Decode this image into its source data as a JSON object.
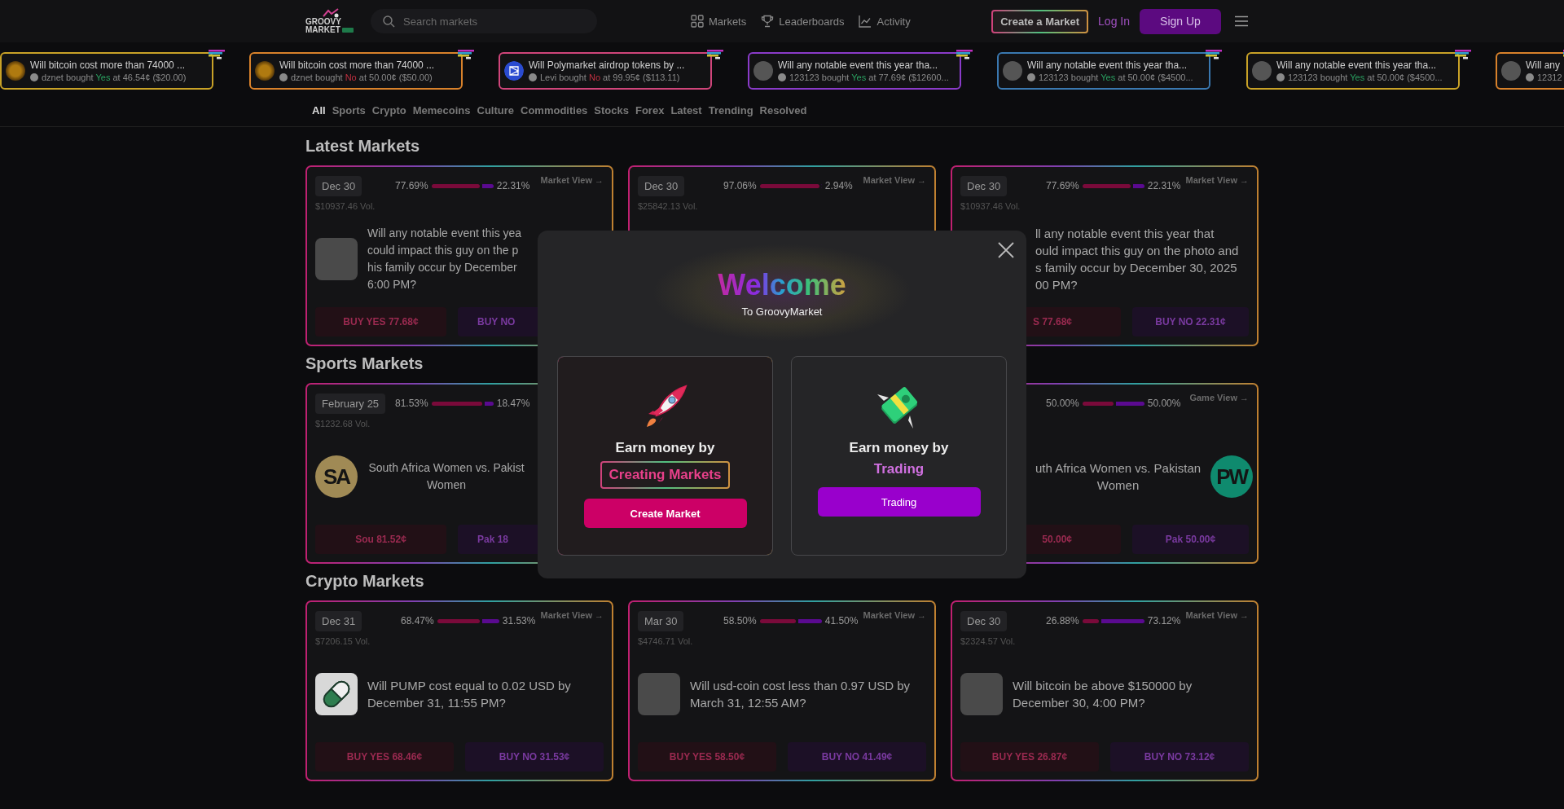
{
  "header": {
    "logo": {
      "line1": "GROOVY",
      "line2": "MARKET"
    },
    "search": {
      "placeholder": "Search markets"
    },
    "nav": [
      {
        "label": "Markets"
      },
      {
        "label": "Leaderboards"
      },
      {
        "label": "Activity"
      }
    ],
    "create_market": "Create a Market",
    "login": "Log In",
    "signup": "Sign Up"
  },
  "ticker": [
    {
      "title": "Will bitcoin cost more than 74000 ...",
      "user": "dznet",
      "verb": "bought",
      "side": {
        "label": "Yes",
        "kind": "yes"
      },
      "detail": "at 46.54¢ ($20.00)",
      "color": "#c9a227",
      "avatar": {
        "kind": "coin"
      }
    },
    {
      "title": "Will bitcoin cost more than 74000 ...",
      "user": "dznet",
      "verb": "bought",
      "side": {
        "label": "No",
        "kind": "no"
      },
      "detail": "at 50.00¢ ($50.00)",
      "color": "#d9822b",
      "avatar": {
        "kind": "coin"
      }
    },
    {
      "title": "Will Polymarket airdrop tokens by ...",
      "user": "Levi",
      "verb": "bought",
      "side": {
        "label": "No",
        "kind": "no"
      },
      "detail": "at 99.95¢ ($113.11)",
      "color": "#d0457a",
      "avatar": {
        "kind": "logo"
      }
    },
    {
      "title": "Will any notable event this year tha...",
      "user": "123123",
      "verb": "bought",
      "side": {
        "label": "Yes",
        "kind": "yes"
      },
      "detail": "at 77.69¢ ($12600...",
      "color": "#8a3bc9",
      "avatar": {
        "kind": "photo"
      }
    },
    {
      "title": "Will any notable event this year tha...",
      "user": "123123",
      "verb": "bought",
      "side": {
        "label": "Yes",
        "kind": "yes"
      },
      "detail": "at 50.00¢ ($4500...",
      "color": "#3a78b0",
      "avatar": {
        "kind": "photo"
      }
    },
    {
      "title": "Will any notable event this year tha...",
      "user": "123123",
      "verb": "bought",
      "side": {
        "label": "Yes",
        "kind": "yes"
      },
      "detail": "at 50.00¢ ($4500...",
      "color": "#c9a227",
      "avatar": {
        "kind": "photo"
      }
    },
    {
      "title": "Will any",
      "user": "12312",
      "color": "#d9822b",
      "avatar": {
        "kind": "photo"
      }
    }
  ],
  "categories": [
    {
      "label": "All",
      "selected": true
    },
    {
      "label": "Sports",
      "selected": false
    },
    {
      "label": "Crypto",
      "selected": false
    },
    {
      "label": "Memecoins",
      "selected": false
    },
    {
      "label": "Culture",
      "selected": false
    },
    {
      "label": "Commodities",
      "selected": false
    },
    {
      "label": "Stocks",
      "selected": false
    },
    {
      "label": "Forex",
      "selected": false
    },
    {
      "label": "Latest",
      "selected": false
    },
    {
      "label": "Trending",
      "selected": false
    },
    {
      "label": "Resolved",
      "selected": false
    }
  ],
  "sections": [
    {
      "title": "Latest Markets",
      "cards": [
        {
          "kind": "market",
          "date": "Dec 30",
          "yes_pct": "77.69%",
          "no_pct": "22.31%",
          "level": 0.7769,
          "link": "Market View →",
          "volume": "$10937.46 Vol.",
          "avatar": {
            "kind": "photo"
          },
          "question_lines": [
            "Will any notable event this yea",
            "could impact this guy on the p",
            "his family occur by December",
            "6:00 PM?"
          ],
          "buttons": [
            {
              "label": "BUY YES 77.68¢",
              "kind": "yes"
            },
            {
              "label": "BUY NO",
              "kind": "no"
            }
          ]
        },
        {
          "kind": "market",
          "date": "Dec 30",
          "yes_pct": "97.06%",
          "no_pct": "2.94%",
          "level": 0.9706,
          "link": "Market View →",
          "volume": "$25842.13 Vol."
        },
        {
          "kind": "market",
          "date": "Dec 30",
          "yes_pct": "77.69%",
          "no_pct": "22.31%",
          "level": 0.7769,
          "link": "Market View →",
          "volume": "$10937.46 Vol.",
          "question_lines": [
            "ll any notable event this year that",
            "ould impact this guy on the photo and",
            "s family occur by December 30, 2025",
            "00 PM?"
          ],
          "buttons": [
            {
              "label": "S 77.68¢",
              "kind": "yes"
            },
            {
              "label": "BUY NO 22.31¢",
              "kind": "no"
            }
          ]
        }
      ]
    },
    {
      "title": "Sports Markets",
      "cards": [
        {
          "kind": "game",
          "date": "February 25",
          "yes_pct": "81.53%",
          "no_pct": "18.47%",
          "level": 0.8153,
          "volume": "$1232.68 Vol.",
          "avatar": {
            "kind": "initials",
            "text": "SA",
            "color": "#a08a55"
          },
          "question_lines": [
            "South Africa Women vs. Pakist",
            "Women"
          ],
          "buttons": [
            {
              "label": "Sou 81.52¢",
              "kind": "yes"
            },
            {
              "label": "Pak 18",
              "kind": "no"
            }
          ]
        },
        {
          "kind": "game"
        },
        {
          "kind": "game",
          "yes_pct": "50.00%",
          "no_pct": "50.00%",
          "level": 0.5,
          "link": "Game View →",
          "right_avatar": {
            "kind": "initials",
            "text": "PW",
            "color": "#0f8a6e"
          },
          "question_lines": [
            "uth Africa Women vs. Pakistan",
            "Women"
          ],
          "buttons": [
            {
              "label": "50.00¢",
              "kind": "yes"
            },
            {
              "label": "Pak 50.00¢",
              "kind": "no"
            }
          ]
        }
      ]
    },
    {
      "title": "Crypto Markets",
      "cards": [
        {
          "kind": "market",
          "date": "Dec 31",
          "yes_pct": "68.47%",
          "no_pct": "31.53%",
          "level": 0.6847,
          "link": "Market View →",
          "volume": "$7206.15 Vol.",
          "avatar": {
            "kind": "pill"
          },
          "question_lines": [
            "Will PUMP cost equal to 0.02 USD by",
            "December 31, 11:55 PM?"
          ],
          "buttons": [
            {
              "label": "BUY YES 68.46¢",
              "kind": "yes"
            },
            {
              "label": "BUY NO 31.53¢",
              "kind": "no"
            }
          ]
        },
        {
          "kind": "market",
          "date": "Mar 30",
          "yes_pct": "58.50%",
          "no_pct": "41.50%",
          "level": 0.585,
          "link": "Market View →",
          "volume": "$4746.71 Vol.",
          "avatar": {
            "kind": "photo"
          },
          "question_lines": [
            "Will usd-coin cost less than 0.97 USD by",
            "March 31, 12:55 AM?"
          ],
          "buttons": [
            {
              "label": "BUY YES 58.50¢",
              "kind": "yes"
            },
            {
              "label": "BUY NO 41.49¢",
              "kind": "no"
            }
          ]
        },
        {
          "kind": "market",
          "date": "Dec 30",
          "yes_pct": "26.88%",
          "no_pct": "73.12%",
          "level": 0.2688,
          "link": "Market View →",
          "volume": "$2324.57 Vol.",
          "avatar": {
            "kind": "photo"
          },
          "question_lines": [
            "Will bitcoin be above $150000 by",
            "December 30, 4:00 PM?"
          ],
          "buttons": [
            {
              "label": "BUY YES 26.87¢",
              "kind": "yes"
            },
            {
              "label": "BUY NO 73.12¢",
              "kind": "no"
            }
          ]
        }
      ]
    }
  ],
  "modal": {
    "title": "Welcome",
    "subtitle": "To GroovyMarket",
    "options": [
      {
        "kind": "create",
        "line1": "Earn money by",
        "highlight": "Creating Markets",
        "button": "Create Market"
      },
      {
        "kind": "trade",
        "line1": "Earn money by",
        "highlight": "Trading",
        "button": "Trading"
      }
    ]
  }
}
